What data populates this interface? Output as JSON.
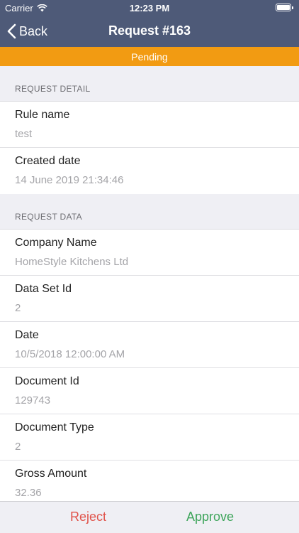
{
  "status_bar": {
    "carrier": "Carrier",
    "time": "12:23 PM"
  },
  "nav": {
    "back_label": "Back",
    "title": "Request #163"
  },
  "status_banner": {
    "label": "Pending",
    "color": "#f29b12"
  },
  "sections": {
    "detail": {
      "header": "REQUEST DETAIL",
      "items": [
        {
          "label": "Rule name",
          "value": "test"
        },
        {
          "label": "Created date",
          "value": "14 June 2019 21:34:46"
        }
      ]
    },
    "data": {
      "header": "REQUEST DATA",
      "items": [
        {
          "label": "Company Name",
          "value": "HomeStyle Kitchens Ltd"
        },
        {
          "label": "Data Set Id",
          "value": "2"
        },
        {
          "label": "Date",
          "value": "10/5/2018 12:00:00 AM"
        },
        {
          "label": "Document Id",
          "value": "129743"
        },
        {
          "label": "Document Type",
          "value": "2"
        },
        {
          "label": "Gross Amount",
          "value": "32.36"
        }
      ]
    }
  },
  "toolbar": {
    "reject_label": "Reject",
    "approve_label": "Approve"
  },
  "colors": {
    "nav": "#4e5a78",
    "reject": "#e0524a",
    "approve": "#3ea55b"
  }
}
